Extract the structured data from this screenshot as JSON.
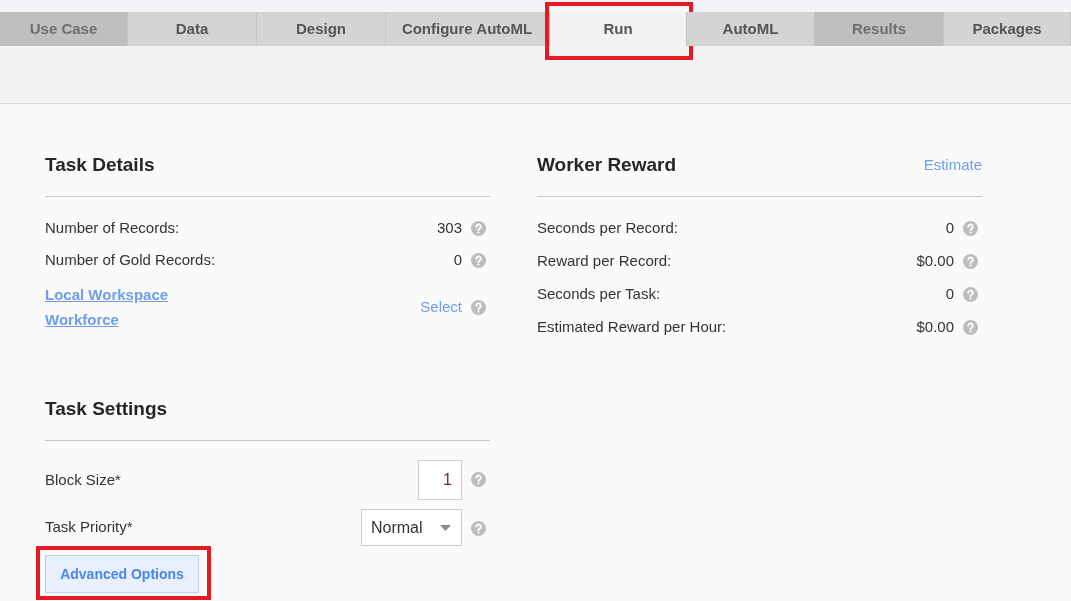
{
  "tabs": [
    {
      "label": "Use Case",
      "selected": false,
      "disabled": true,
      "highlighted": false
    },
    {
      "label": "Data",
      "selected": false,
      "disabled": false,
      "highlighted": false
    },
    {
      "label": "Design",
      "selected": false,
      "disabled": false,
      "highlighted": false
    },
    {
      "label": "Configure AutoML",
      "selected": false,
      "disabled": false,
      "highlighted": false
    },
    {
      "label": "Run",
      "selected": true,
      "disabled": false,
      "highlighted": true
    },
    {
      "label": "AutoML",
      "selected": false,
      "disabled": false,
      "highlighted": false
    },
    {
      "label": "Results",
      "selected": false,
      "disabled": true,
      "highlighted": false
    },
    {
      "label": "Packages",
      "selected": false,
      "disabled": false,
      "highlighted": false
    }
  ],
  "task_details": {
    "title": "Task Details",
    "rows": [
      {
        "label": "Number of Records:",
        "value": "303"
      },
      {
        "label": "Number of Gold Records:",
        "value": "0"
      }
    ],
    "workforce": {
      "link": "Local Workspace Workforce",
      "action": "Select"
    }
  },
  "worker_reward": {
    "title": "Worker Reward",
    "action": "Estimate",
    "rows": [
      {
        "label": "Seconds per Record:",
        "value": "0"
      },
      {
        "label": "Reward per Record:",
        "value": "$0.00"
      },
      {
        "label": "Seconds per Task:",
        "value": "0"
      },
      {
        "label": "Estimated Reward per Hour:",
        "value": "$0.00"
      }
    ]
  },
  "task_settings": {
    "title": "Task Settings",
    "fields": [
      {
        "kind": "number",
        "label": "Block Size*",
        "value": "1"
      },
      {
        "kind": "select",
        "label": "Task Priority*",
        "value": "Normal"
      }
    ],
    "advanced_button": {
      "label": "Advanced Options",
      "highlighted": true
    }
  }
}
